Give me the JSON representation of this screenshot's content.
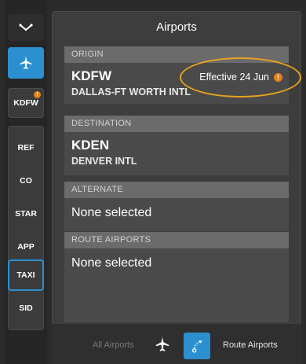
{
  "sidebar": {
    "top_icon": "chevron-down-icon",
    "plane_icon": "airplane-icon",
    "airport_badge_label": "KDFW",
    "items": [
      {
        "label": "REF"
      },
      {
        "label": "CO"
      },
      {
        "label": "STAR"
      },
      {
        "label": "APP"
      },
      {
        "label": "TAXI"
      },
      {
        "label": "SID"
      }
    ]
  },
  "panel": {
    "title": "Airports",
    "origin": {
      "header": "ORIGIN",
      "code": "KDFW",
      "name": "DALLAS-FT WORTH INTL",
      "effective": "Effective 24 Jun"
    },
    "destination": {
      "header": "DESTINATION",
      "code": "KDEN",
      "name": "DENVER INTL"
    },
    "alternate": {
      "header": "ALTERNATE",
      "value": "None selected"
    },
    "route_airports": {
      "header": "ROUTE AIRPORTS",
      "value": "None selected"
    }
  },
  "bottom_bar": {
    "all_airports_label": "All Airports",
    "route_airports_label": "Route Airports"
  },
  "colors": {
    "accent_blue": "#2c8fd0",
    "warning_orange": "#e8811a",
    "highlight_ring": "#e8a21e"
  },
  "warning_glyph": "!"
}
